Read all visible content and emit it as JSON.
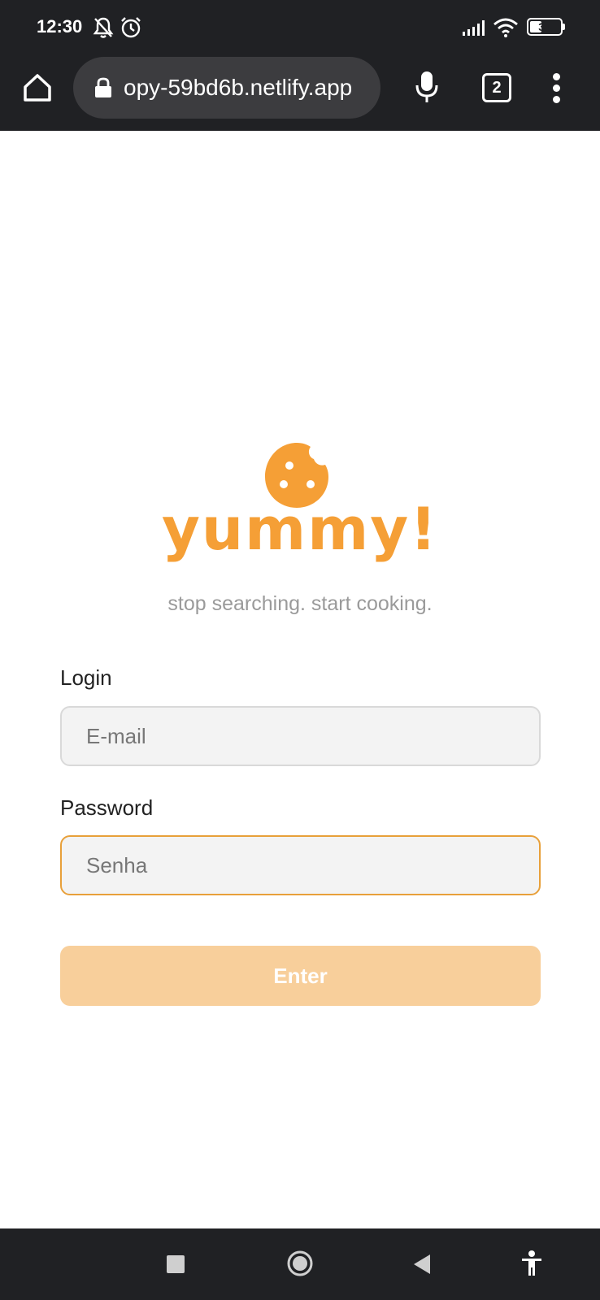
{
  "status_bar": {
    "time": "12:30",
    "battery_level": "34",
    "icons": [
      "bell-off-icon",
      "alarm-icon",
      "signal-icon",
      "wifi-icon",
      "battery-icon"
    ]
  },
  "browser": {
    "url": "opy-59bd6b.netlify.app",
    "tab_count": "2",
    "icons": [
      "home-icon",
      "lock-icon",
      "mic-icon",
      "tabs-icon",
      "more-vert-icon"
    ]
  },
  "app": {
    "brand_name": "yummy!",
    "tagline": "stop searching. start cooking.",
    "accent_color": "#f59f36",
    "login_label": "Login",
    "email_placeholder": "E-mail",
    "password_label": "Password",
    "password_placeholder": "Senha",
    "enter_label": "Enter",
    "button_color": "#f8cf9b"
  },
  "nav_bar": {
    "icons": [
      "recent-apps-icon",
      "home-circle-icon",
      "back-icon",
      "accessibility-icon"
    ]
  }
}
